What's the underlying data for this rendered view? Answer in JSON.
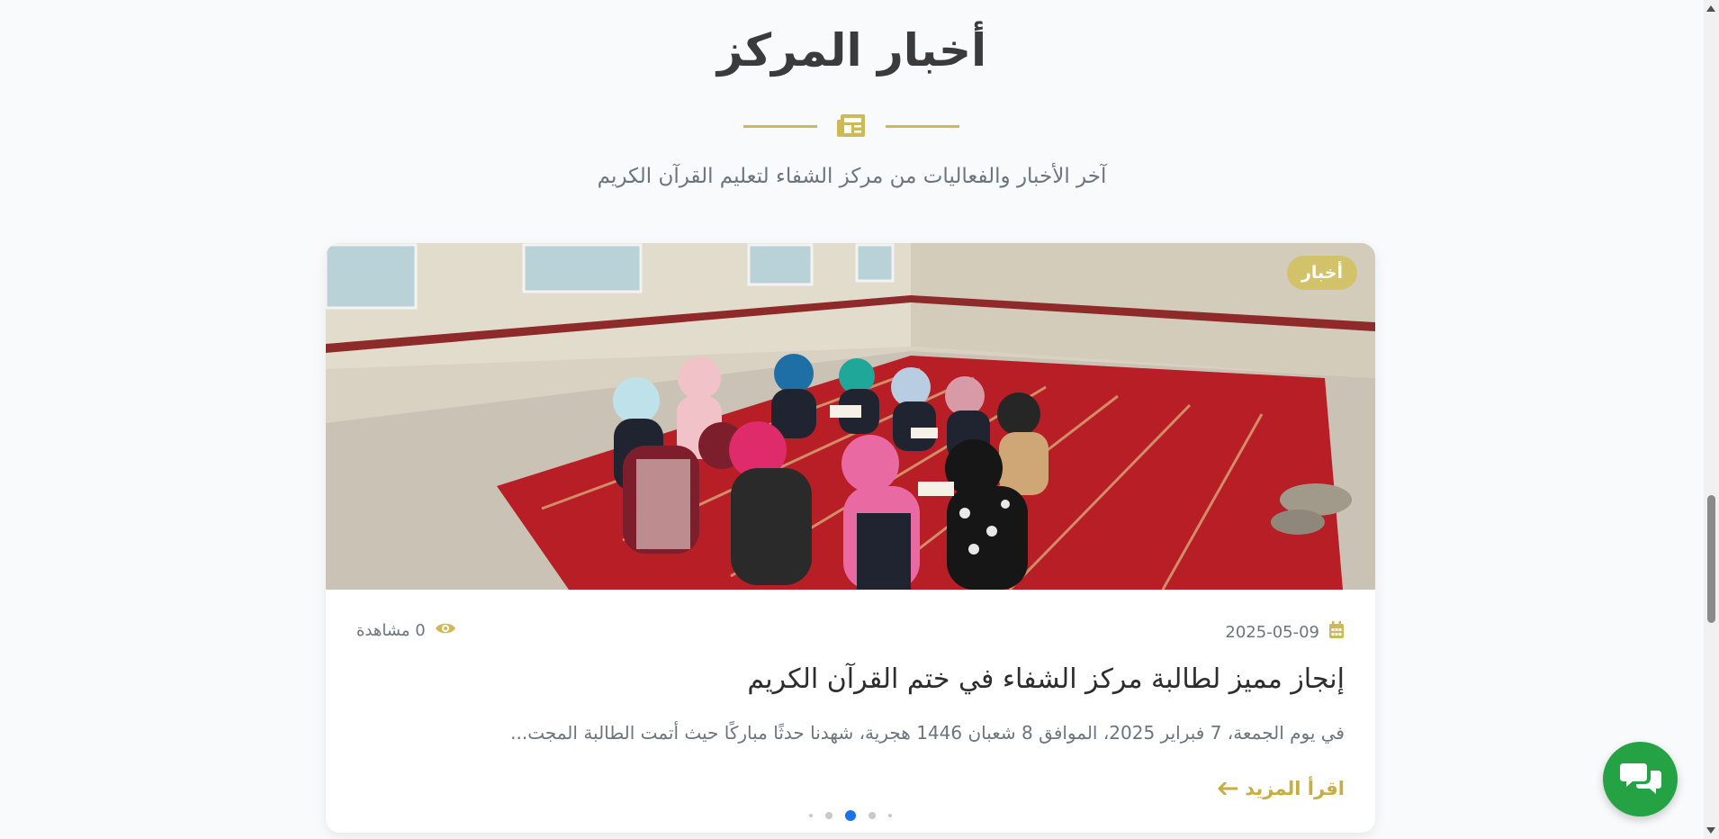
{
  "section": {
    "title": "أخبار المركز",
    "subtitle": "آخر الأخبار والفعاليات من مركز الشفاء لتعليم القرآن الكريم"
  },
  "card": {
    "badge": "أخبار",
    "date": "2025-05-09",
    "views": "0 مشاهدة",
    "title": "إنجاز مميز لطالبة مركز الشفاء في ختم القرآن الكريم",
    "excerpt": "في يوم الجمعة، 7 فبراير 2025، الموافق 8 شعبان 1446 هجرية، شهدنا حدثًا مباركًا حيث أتمت الطالبة المجت...",
    "read_more": "اقرأ المزيد"
  },
  "carousel": {
    "dot_count": 5,
    "active_index": 2
  },
  "icons": {
    "divider": "newspaper-icon",
    "date": "calendar-icon",
    "views": "eye-icon",
    "read_more": "arrow-left-icon",
    "chat": "comments-icon"
  },
  "colors": {
    "accent": "#cdb95a",
    "chat": "#25a244",
    "active_dot": "#1a73e8"
  }
}
